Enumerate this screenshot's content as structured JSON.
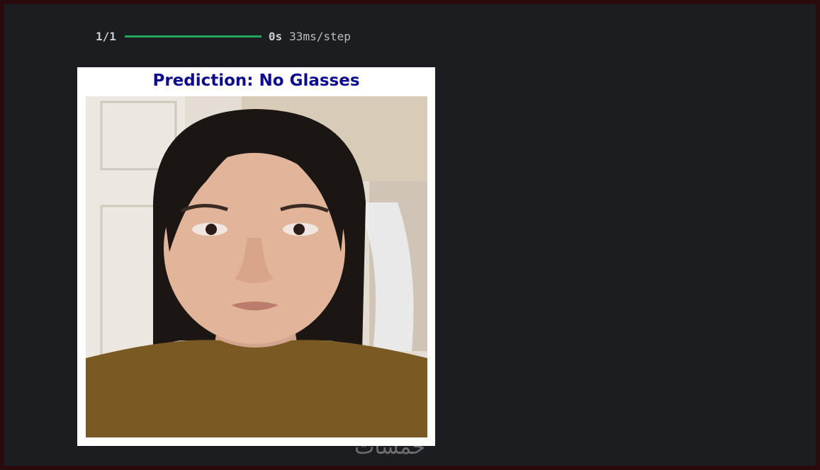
{
  "progress": {
    "step_count": "1/1",
    "fraction": 1.0,
    "elapsed": "0s",
    "rate": "33ms/step",
    "bar_color": "#22a559"
  },
  "figure": {
    "title": "Prediction: No Glasses",
    "title_color": "#0d0d8c",
    "image_subject": "portrait photo of a woman with dark hair in an olive top"
  },
  "watermark": {
    "text": "خمسات"
  }
}
